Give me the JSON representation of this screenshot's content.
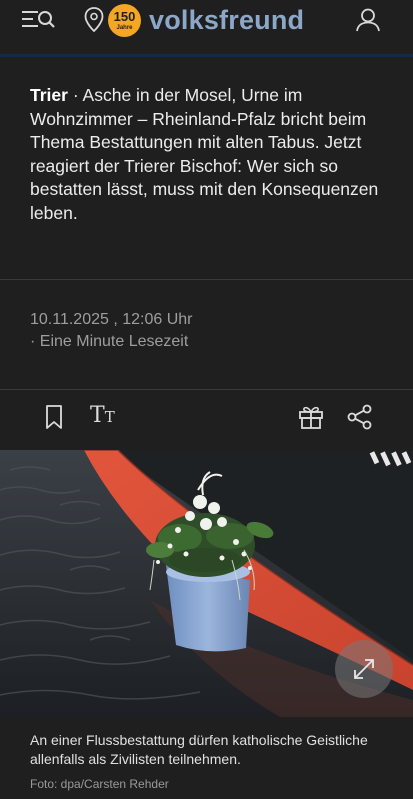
{
  "header": {
    "brand": "volksfreund",
    "badge_number": "150",
    "badge_sub": "Jahre",
    "icons": [
      "menu-search-icon",
      "location-pin-icon",
      "account-icon"
    ]
  },
  "article": {
    "topic": "Trier",
    "separator": " · ",
    "lead": "Asche in der Mosel, Urne im Wohnzimmer – Rheinland-Pfalz bricht beim Thema Bestattungen mit alten Tabus. Jetzt reagiert der Trierer Bischof: Wer sich so bestatten lässt, muss mit den Konsequenzen leben.",
    "date": "10.11.2025 , 12:06 Uhr",
    "reading_time": "· Eine Minute Lesezeit"
  },
  "actions": {
    "text_size": "T",
    "text_size_small": "T",
    "icons": [
      "bookmark-icon",
      "text-size-icon",
      "gift-icon",
      "share-icon"
    ]
  },
  "image": {
    "caption": "An einer Flussbestattung dürfen katholische Geistliche allenfalls als Zivilisten teilnehmen.",
    "credit": "Foto: dpa/Carsten Rehder"
  }
}
